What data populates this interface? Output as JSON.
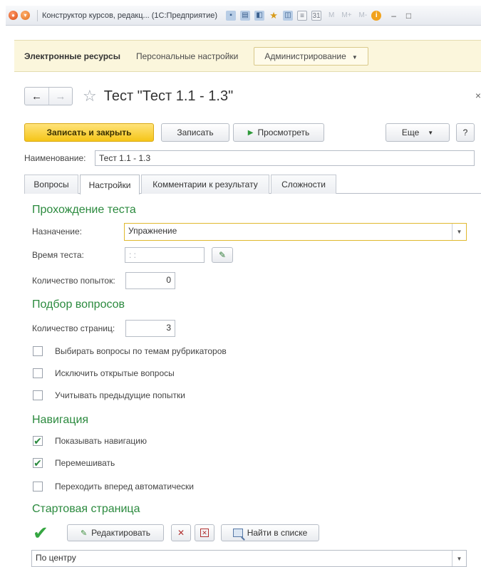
{
  "window": {
    "title": "Конструктор курсов, редакц... (1С:Предприятие)",
    "m_buttons": [
      "M",
      "M+",
      "M-"
    ]
  },
  "menu": {
    "items": [
      {
        "label": "Электронные ресурсы"
      },
      {
        "label": "Персональные настройки"
      },
      {
        "label": "Администрирование"
      }
    ]
  },
  "form": {
    "title": "Тест \"Тест 1.1 - 1.3\"",
    "close_symbol": "×"
  },
  "toolbar": {
    "save_close": "Записать и закрыть",
    "save": "Записать",
    "preview": "Просмотреть",
    "more": "Еще",
    "help": "?"
  },
  "name_field": {
    "label": "Наименование:",
    "value": "Тест 1.1 - 1.3"
  },
  "tabs": [
    {
      "label": "Вопросы",
      "active": false
    },
    {
      "label": "Настройки",
      "active": true
    },
    {
      "label": "Комментарии к результату",
      "active": false
    },
    {
      "label": "Сложности",
      "active": false
    }
  ],
  "sections": {
    "passing": {
      "title": "Прохождение теста",
      "purpose_label": "Назначение:",
      "purpose_value": "Упражнение",
      "time_label": "Время теста:",
      "time_value": ": :",
      "attempts_label": "Количество попыток:",
      "attempts_value": "0"
    },
    "questions": {
      "title": "Подбор вопросов",
      "pages_label": "Количество страниц:",
      "pages_value": "3",
      "checkboxes": [
        {
          "label": "Выбирать вопросы по темам рубрикаторов",
          "checked": false
        },
        {
          "label": "Исключить открытые вопросы",
          "checked": false
        },
        {
          "label": "Учитывать предыдущие попытки",
          "checked": false
        }
      ]
    },
    "navigation": {
      "title": "Навигация",
      "checkboxes": [
        {
          "label": "Показывать навигацию",
          "checked": true
        },
        {
          "label": "Перемешивать",
          "checked": true
        },
        {
          "label": "Переходить вперед автоматически",
          "checked": false
        }
      ]
    },
    "start_page": {
      "title": "Стартовая страница",
      "edit_label": "Редактировать",
      "find_label": "Найти в списке",
      "align_value": "По центру"
    }
  },
  "colors": {
    "accent_green": "#2b8a3e",
    "primary_button": "#f5c518",
    "menubar_bg": "#fbf6dc"
  }
}
